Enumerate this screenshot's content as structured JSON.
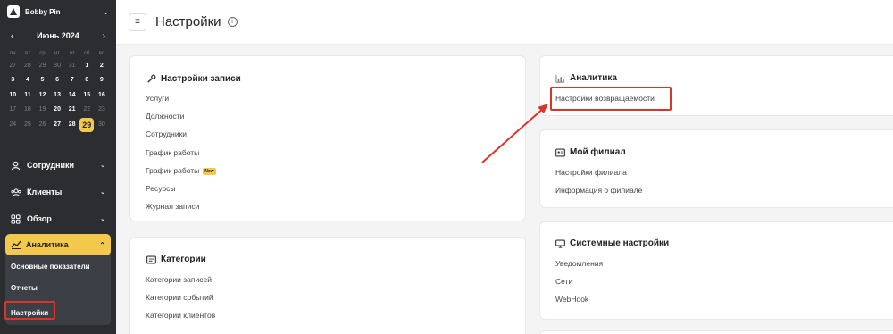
{
  "brand": {
    "name": "Bobby Pin"
  },
  "calendar": {
    "title": "Июнь 2024",
    "dows": [
      "пн",
      "вт",
      "ср",
      "чт",
      "пт",
      "сб",
      "вс"
    ],
    "weeks": [
      [
        {
          "d": "27",
          "m": true
        },
        {
          "d": "28",
          "m": true
        },
        {
          "d": "29",
          "m": true
        },
        {
          "d": "30",
          "m": true
        },
        {
          "d": "31",
          "m": true
        },
        {
          "d": "1"
        },
        {
          "d": "2"
        }
      ],
      [
        {
          "d": "3"
        },
        {
          "d": "4"
        },
        {
          "d": "5"
        },
        {
          "d": "6"
        },
        {
          "d": "7"
        },
        {
          "d": "8"
        },
        {
          "d": "9"
        }
      ],
      [
        {
          "d": "10"
        },
        {
          "d": "11"
        },
        {
          "d": "12"
        },
        {
          "d": "13"
        },
        {
          "d": "14"
        },
        {
          "d": "15"
        },
        {
          "d": "16"
        }
      ],
      [
        {
          "d": "17",
          "m": true
        },
        {
          "d": "18",
          "m": true
        },
        {
          "d": "19",
          "m": true
        },
        {
          "d": "20"
        },
        {
          "d": "21"
        },
        {
          "d": "22",
          "m": true
        },
        {
          "d": "23",
          "m": true
        }
      ],
      [
        {
          "d": "24",
          "m": true
        },
        {
          "d": "25",
          "m": true
        },
        {
          "d": "26",
          "m": true
        },
        {
          "d": "27"
        },
        {
          "d": "28"
        },
        {
          "d": "29",
          "t": true
        },
        {
          "d": "30",
          "m": true
        }
      ]
    ]
  },
  "nav": {
    "items": [
      {
        "label": "Сотрудники",
        "icon": "user-icon"
      },
      {
        "label": "Клиенты",
        "icon": "clients-icon"
      },
      {
        "label": "Обзор",
        "icon": "grid-icon"
      }
    ],
    "active": {
      "label": "Аналитика",
      "icon": "analytics-icon",
      "sub": [
        "Основные показатели",
        "Отчеты",
        "Настройки"
      ]
    }
  },
  "header": {
    "title": "Настройки",
    "menu_icon": "≡",
    "info_icon": "i"
  },
  "cards": {
    "record": {
      "title": "Настройки записи",
      "links": [
        "Услуги",
        "Должности",
        "Сотрудники",
        "График работы",
        "График работы",
        "Ресурсы",
        "Журнал записи"
      ],
      "badge": "New"
    },
    "categories": {
      "title": "Категории",
      "links": [
        "Категории записей",
        "Категории событий",
        "Категории клиентов"
      ]
    },
    "analytics": {
      "title": "Аналитика",
      "links": [
        "Настройки возвращаемости"
      ]
    },
    "branch": {
      "title": "Мой филиал",
      "links": [
        "Настройки филиала",
        "Информация о филиале"
      ]
    },
    "system": {
      "title": "Системные настройки",
      "links": [
        "Уведомления",
        "Сети",
        "WebHook"
      ]
    }
  },
  "colors": {
    "accent": "#f2c94c",
    "highlight": "#d9352b",
    "sidebar": "#2b2d31"
  }
}
